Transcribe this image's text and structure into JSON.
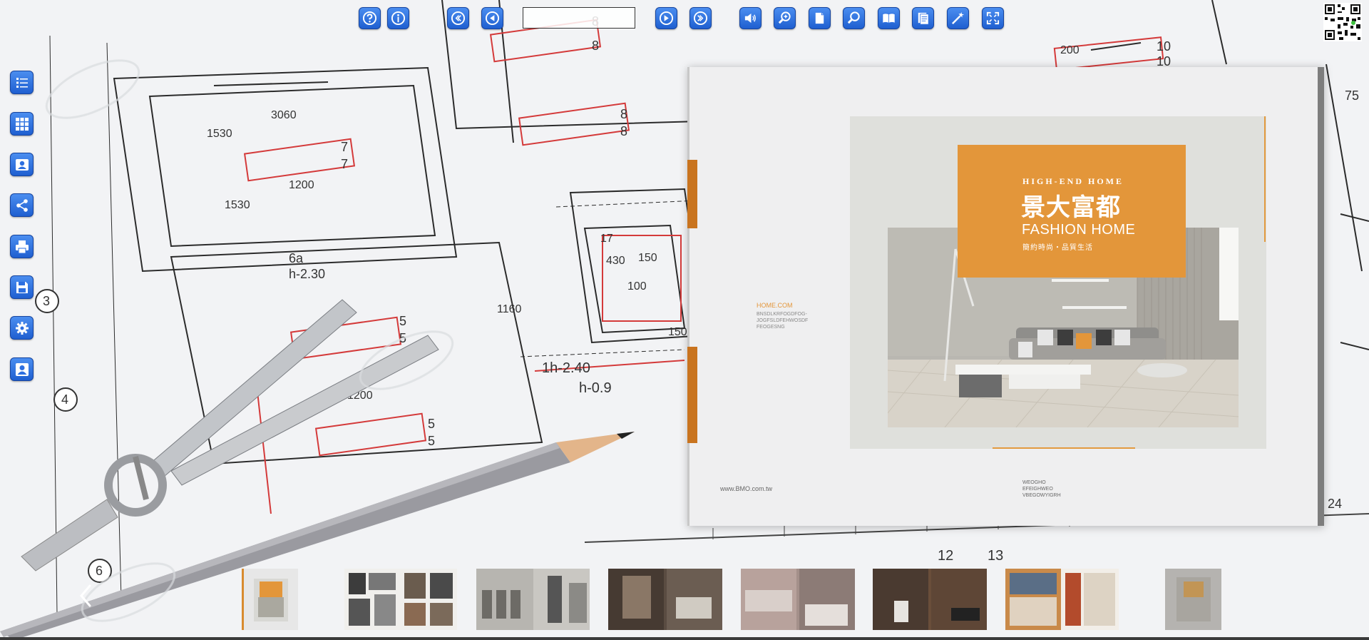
{
  "toolbar": {
    "page_input_value": "",
    "buttons": [
      {
        "name": "help-button",
        "icon": "help-icon"
      },
      {
        "name": "about-button",
        "icon": "info-icon"
      },
      {
        "name": "first-page-button",
        "icon": "first-page-icon"
      },
      {
        "name": "previous-page-button",
        "icon": "previous-page-icon"
      },
      {
        "name": "next-page-button",
        "icon": "next-page-icon"
      },
      {
        "name": "last-page-button",
        "icon": "last-page-icon"
      },
      {
        "name": "sound-button",
        "icon": "speaker-icon"
      },
      {
        "name": "zoom-in-button",
        "icon": "zoom-in-icon"
      },
      {
        "name": "single-page-button",
        "icon": "single-page-icon"
      },
      {
        "name": "search-button",
        "icon": "search-icon"
      },
      {
        "name": "double-page-button",
        "icon": "open-book-icon"
      },
      {
        "name": "text-mode-button",
        "icon": "document-list-icon"
      },
      {
        "name": "auto-flip-button",
        "icon": "magic-wand-icon"
      },
      {
        "name": "fullscreen-button",
        "icon": "fullscreen-icon"
      }
    ]
  },
  "sidebar": {
    "items": [
      {
        "name": "table-of-contents-button",
        "icon": "list-icon"
      },
      {
        "name": "thumbnails-button",
        "icon": "grid-icon"
      },
      {
        "name": "contact-button",
        "icon": "contact-card-icon"
      },
      {
        "name": "share-button",
        "icon": "share-icon"
      },
      {
        "name": "print-button",
        "icon": "printer-icon"
      },
      {
        "name": "download-pdf-button",
        "icon": "save-icon"
      },
      {
        "name": "settings-button",
        "icon": "gear-icon"
      },
      {
        "name": "user-button",
        "icon": "user-icon"
      }
    ]
  },
  "page": {
    "subtitle": "HIGH-END HOME",
    "title": "景大富都",
    "title_en": "FASHION HOME",
    "tagline": "簡約時尚・品質生活",
    "home_com": "HOME.COM",
    "filler_text": [
      "BNSDLKRFOGDFOG-",
      "JOGFSLDFEHWOSDF",
      "FEOGESNG"
    ],
    "url": "www.BMO.com.tw",
    "footer_text": [
      "WEOGHO",
      "EFEIGHWEO",
      "VBEGOWYIGRH"
    ]
  },
  "thumbnails": [
    {
      "name": "thumbnail-page-1",
      "label": "cover"
    },
    {
      "name": "thumbnail-page-2-3",
      "label": "interior gallery"
    },
    {
      "name": "thumbnail-page-4-5",
      "label": "storefront"
    },
    {
      "name": "thumbnail-page-6-7",
      "label": "living room"
    },
    {
      "name": "thumbnail-page-8-9",
      "label": "kitchen"
    },
    {
      "name": "thumbnail-page-10-11",
      "label": "bathroom"
    },
    {
      "name": "thumbnail-page-12-13",
      "label": "brochure"
    },
    {
      "name": "thumbnail-page-14",
      "label": "back cover"
    }
  ],
  "colors": {
    "accent": "#e3963a",
    "button_blue": "#2d6fe0"
  }
}
